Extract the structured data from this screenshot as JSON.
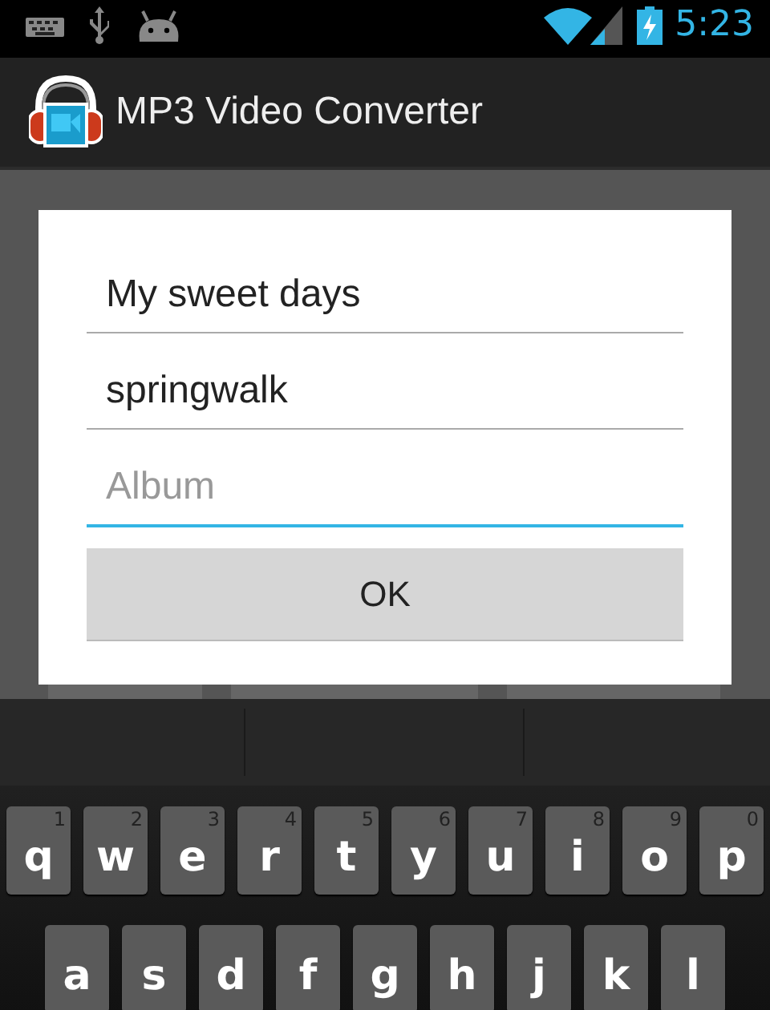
{
  "status_bar": {
    "time": "5:23"
  },
  "app_bar": {
    "title": "MP3 Video Converter"
  },
  "dialog": {
    "fields": [
      {
        "value": "My sweet days",
        "focused": false
      },
      {
        "value": "springwalk",
        "focused": false
      },
      {
        "placeholder": "Album",
        "focused": true
      }
    ],
    "button": "OK"
  },
  "keyboard": {
    "rows": [
      [
        {
          "label": "q",
          "hint": "1"
        },
        {
          "label": "w",
          "hint": "2"
        },
        {
          "label": "e",
          "hint": "3"
        },
        {
          "label": "r",
          "hint": "4"
        },
        {
          "label": "t",
          "hint": "5"
        },
        {
          "label": "y",
          "hint": "6"
        },
        {
          "label": "u",
          "hint": "7"
        },
        {
          "label": "i",
          "hint": "8"
        },
        {
          "label": "o",
          "hint": "9"
        },
        {
          "label": "p",
          "hint": "0"
        }
      ],
      [
        {
          "label": "a"
        },
        {
          "label": "s"
        },
        {
          "label": "d"
        },
        {
          "label": "f"
        },
        {
          "label": "g"
        },
        {
          "label": "h"
        },
        {
          "label": "j"
        },
        {
          "label": "k"
        },
        {
          "label": "l"
        }
      ]
    ]
  }
}
